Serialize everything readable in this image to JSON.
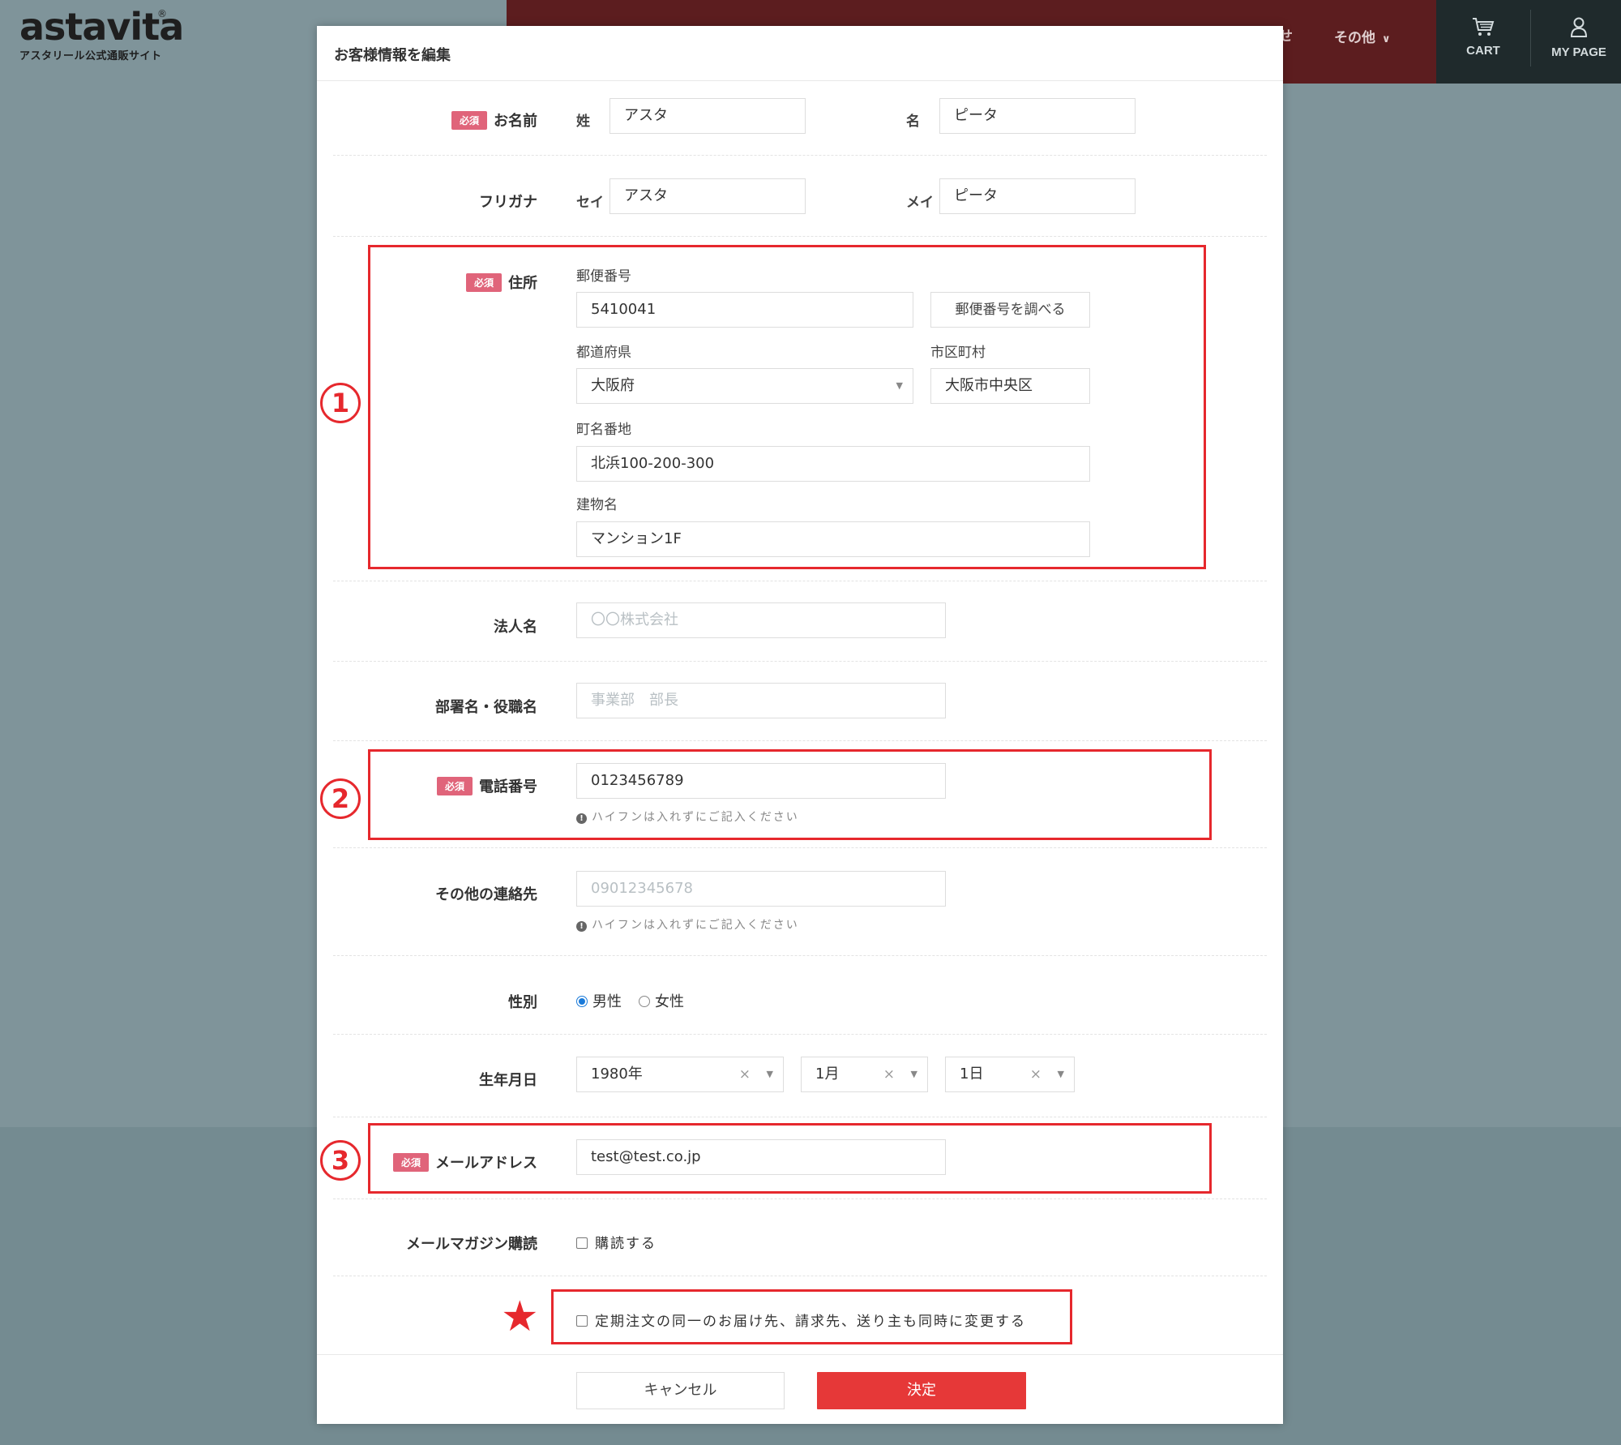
{
  "brand": {
    "logo": "astavita",
    "registered": "®",
    "tagline": "アスタリール公式通販サイト"
  },
  "nav": {
    "partial_label": "せ",
    "other_label": "その他",
    "cart_label": "CART",
    "mypage_label": "MY PAGE"
  },
  "modal": {
    "title": "お客様情報を編集",
    "required_badge": "必須",
    "name": {
      "label": "お名前",
      "last_label": "姓",
      "last_value": "アスタ",
      "first_label": "名",
      "first_value": "ピータ"
    },
    "furigana": {
      "label": "フリガナ",
      "last_label": "セイ",
      "last_value": "アスタ",
      "first_label": "メイ",
      "first_value": "ピータ"
    },
    "address": {
      "label": "住所",
      "postal_label": "郵便番号",
      "postal_value": "5410041",
      "lookup_button": "郵便番号を調べる",
      "prefecture_label": "都道府県",
      "prefecture_value": "大阪府",
      "city_label": "市区町村",
      "city_value": "大阪市中央区",
      "street_label": "町名番地",
      "street_value": "北浜100-200-300",
      "building_label": "建物名",
      "building_value": "マンション1F"
    },
    "company": {
      "label": "法人名",
      "placeholder": "〇〇株式会社"
    },
    "department": {
      "label": "部署名・役職名",
      "placeholder": "事業部　部長"
    },
    "phone": {
      "label": "電話番号",
      "value": "0123456789",
      "hint": "ハイフンは入れずにご記入ください"
    },
    "other_contact": {
      "label": "その他の連絡先",
      "placeholder": "09012345678",
      "hint": "ハイフンは入れずにご記入ください"
    },
    "gender": {
      "label": "性別",
      "options": [
        "男性",
        "女性"
      ],
      "selected": "男性"
    },
    "birthday": {
      "label": "生年月日",
      "year": "1980年",
      "month": "1月",
      "day": "1日",
      "clear": "×"
    },
    "email": {
      "label": "メールアドレス",
      "value": "test@test.co.jp"
    },
    "newsletter": {
      "label": "メールマガジン購読",
      "option": "購読する",
      "checked": false
    },
    "sync_option": {
      "text": "定期注文の同一のお届け先、請求先、送り主も同時に変更する",
      "checked": false
    },
    "cancel_button": "キャンセル",
    "submit_button": "決定"
  },
  "annotations": {
    "marker1": "1",
    "marker2": "2",
    "marker3": "3",
    "star": "★"
  },
  "colors": {
    "accent_red": "#e63838",
    "required_pink": "#e0647a",
    "annotation_red": "#e6282d",
    "overlay": "#7f949a",
    "header_red": "#5c1d1f",
    "header_dark": "#1f2a2c"
  }
}
